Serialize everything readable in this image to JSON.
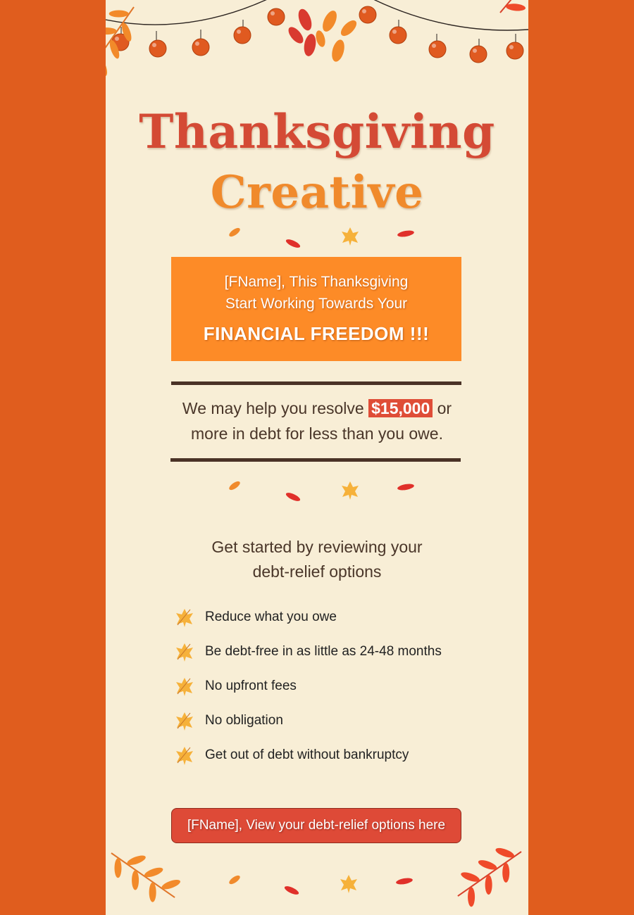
{
  "header": {
    "title_line1": "Thanksgiving",
    "title_line2": "Creative"
  },
  "promo": {
    "line1": "[FName], This Thanksgiving",
    "line2": "Start Working Towards Your",
    "line3": "FINANCIAL FREEDOM !!!"
  },
  "debt_message": {
    "before": "We may help you resolve",
    "amount": "$15,000",
    "after_line1": "or",
    "line2": "more in debt for less than you owe."
  },
  "get_started": {
    "line1": "Get started by reviewing your",
    "line2": "debt-relief options"
  },
  "benefits": [
    "Reduce what you owe",
    "Be debt-free in as little as 24-48 months",
    "No upfront fees",
    "No obligation",
    "Get out of debt without bankruptcy"
  ],
  "cta": {
    "label": "[FName], View your debt-relief options here"
  },
  "colors": {
    "outer_background": "#e05d1e",
    "card_background": "#f8eed6",
    "title_red": "#d44a35",
    "title_orange": "#f08a2c",
    "promo_orange": "#fd8b27",
    "accent_red": "#df4d37",
    "rule_brown": "#4a3226"
  },
  "icons": [
    "autumn-branch-icon",
    "berry-garland-icon",
    "falling-leaf-icon",
    "maple-leaf-bullet-icon"
  ]
}
